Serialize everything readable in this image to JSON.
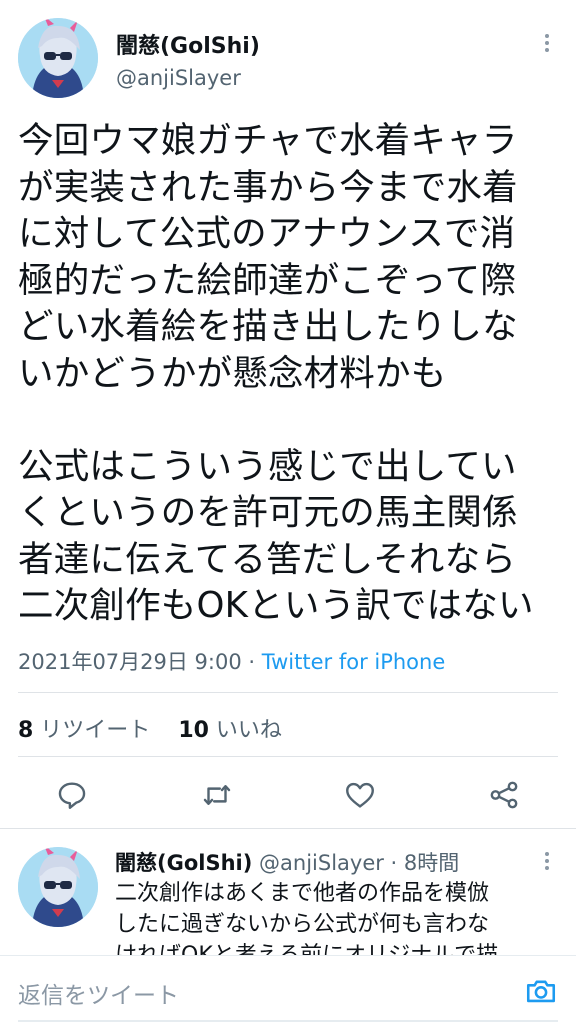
{
  "tweet": {
    "author_name": "闇慈(GolShi)",
    "author_handle": "@anjiSlayer",
    "body_text": "今回ウマ娘ガチャで水着キャラ\nが実装された事から今まで水着\nに対して公式のアナウンスで消\n極的だった絵師達がこぞって際\nどい水着絵を描き出したりしな\nいかどうかが懸念材料かも\n\n公式はこういう感じで出してい\nくというのを許可元の馬主関係\n者達に伝えてる筈だしそれなら\n二次創作もOKという訳ではない",
    "timestamp": "2021年07月29日 9:00",
    "separator": " · ",
    "source": "Twitter for iPhone",
    "retweet_count": "8",
    "retweet_label": " リツイート",
    "like_count": "10",
    "like_label": " いいね"
  },
  "actions": {
    "icons": [
      "reply-icon",
      "retweet-icon",
      "like-icon",
      "share-icon"
    ]
  },
  "reply": {
    "author_name": "闇慈(GolShi)",
    "meta": " @anjiSlayer · 8時間",
    "text": "二次創作はあくまで他者の作品を模倣\nしたに過ぎないから公式が何も言わな\nければOKと考える前にオリジナルで描"
  },
  "compose": {
    "placeholder": "返信をツイート"
  },
  "colors": {
    "accent": "#1d9bf0",
    "secondary_text": "#536471",
    "icon": "#536471"
  }
}
